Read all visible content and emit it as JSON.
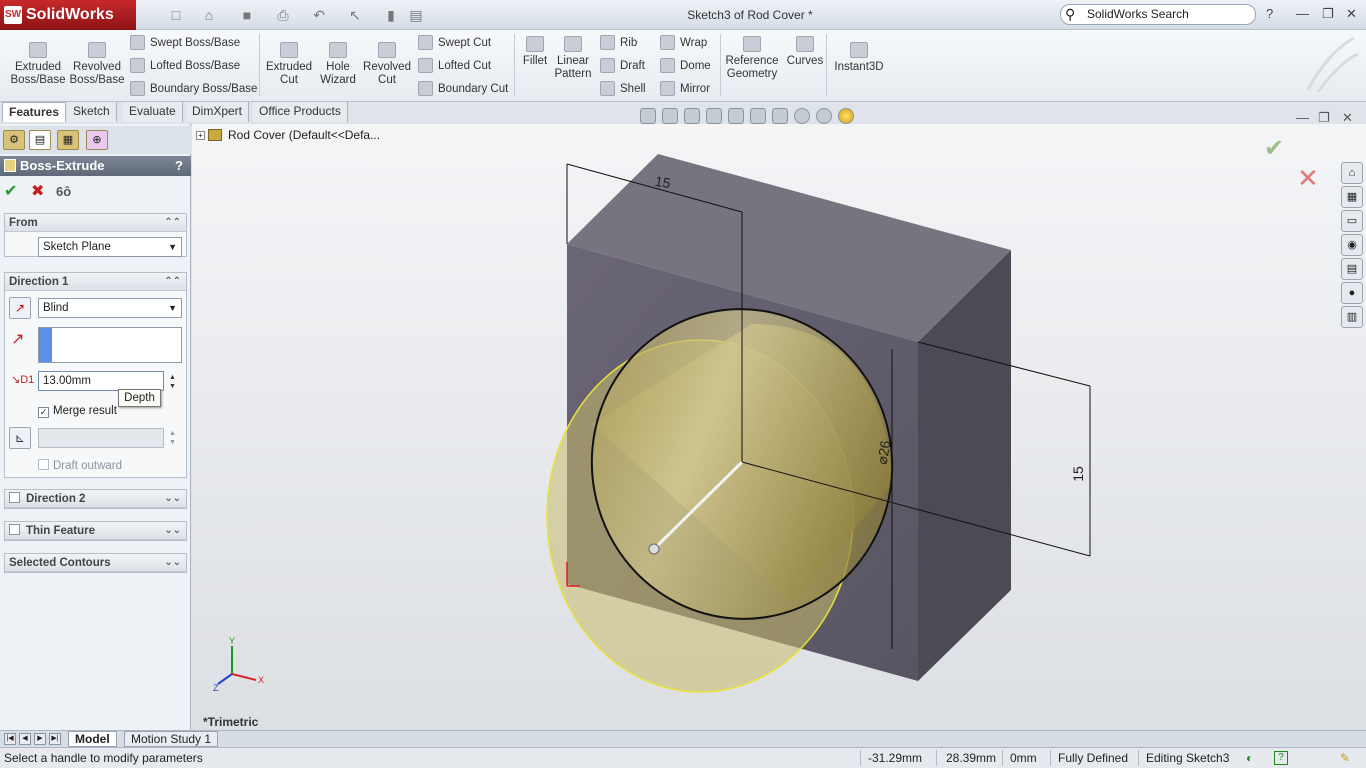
{
  "titlebar": {
    "app_name": "SolidWorks",
    "document_title": "Sketch3 of Rod Cover *",
    "search_placeholder": "SolidWorks Search",
    "help": "?"
  },
  "ribbon": {
    "extruded_boss": "Extruded\nBoss/Base",
    "revolved_boss": "Revolved\nBoss/Base",
    "swept_boss": "Swept Boss/Base",
    "lofted_boss": "Lofted Boss/Base",
    "boundary_boss": "Boundary Boss/Base",
    "extruded_cut": "Extruded\nCut",
    "hole_wizard": "Hole\nWizard",
    "revolved_cut": "Revolved\nCut",
    "swept_cut": "Swept Cut",
    "lofted_cut": "Lofted Cut",
    "boundary_cut": "Boundary Cut",
    "fillet": "Fillet",
    "linear_pattern": "Linear\nPattern",
    "rib": "Rib",
    "draft": "Draft",
    "shell": "Shell",
    "wrap": "Wrap",
    "dome": "Dome",
    "mirror": "Mirror",
    "reference_geometry": "Reference\nGeometry",
    "curves": "Curves",
    "instant3d": "Instant3D"
  },
  "tabs": [
    "Features",
    "Sketch",
    "Evaluate",
    "DimXpert",
    "Office Products"
  ],
  "property_manager": {
    "title": "Boss-Extrude",
    "help": "?",
    "from": {
      "header": "From",
      "value": "Sketch Plane"
    },
    "direction1": {
      "header": "Direction 1",
      "end_condition": "Blind",
      "depth": "13.00mm",
      "depth_tooltip": "Depth",
      "merge_result": "Merge result",
      "draft_outward": "Draft outward"
    },
    "direction2": "Direction 2",
    "thin_feature": "Thin Feature",
    "selected_contours": "Selected Contours"
  },
  "tree": {
    "node": "Rod Cover  (Default<<Defa..."
  },
  "viewport": {
    "view_label": "*Trimetric",
    "dim_top": "15",
    "dim_right": "15",
    "dim_diameter": "⌀26",
    "triad_y": "Y",
    "triad_z": "Z",
    "triad_x": "X"
  },
  "bottom_tabs": [
    "Model",
    "Motion Study 1"
  ],
  "status": {
    "message": "Select a handle to modify parameters",
    "x": "-31.29mm",
    "y": "28.39mm",
    "z": "0mm",
    "state": "Fully Defined",
    "mode": "Editing Sketch3",
    "help": "?"
  },
  "colors": {
    "part_body": "#6e6a78",
    "preview": "#b5a455",
    "accent_red": "#c8282a"
  }
}
